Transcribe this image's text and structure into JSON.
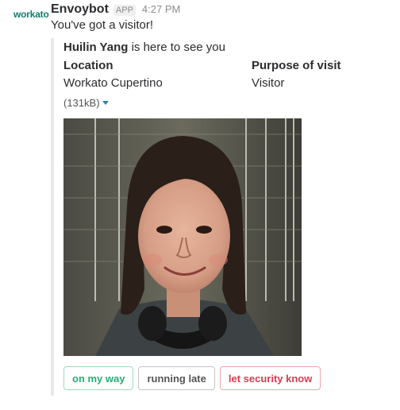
{
  "sender": {
    "avatar_text": "workato",
    "name": "Envoybot",
    "badge": "APP",
    "time": "4:27 PM",
    "message": "You've got a visitor!"
  },
  "attachment": {
    "visitor_name": "Huilin Yang",
    "visitor_suffix": " is here to see you",
    "fields": [
      {
        "title": "Location",
        "value": "Workato Cupertino"
      },
      {
        "title": "Purpose of visit",
        "value": "Visitor"
      }
    ],
    "file_size": "(131kB)",
    "image": {
      "icon": "visitor-photo"
    },
    "actions": [
      {
        "label": "on my way",
        "style": "primary"
      },
      {
        "label": "running late",
        "style": "default"
      },
      {
        "label": "let security know",
        "style": "danger"
      }
    ]
  },
  "colors": {
    "avatar_brand": "#117c6f",
    "primary_button": "#2bac76",
    "danger_button": "#e0394f",
    "caret": "#2a80b9"
  }
}
